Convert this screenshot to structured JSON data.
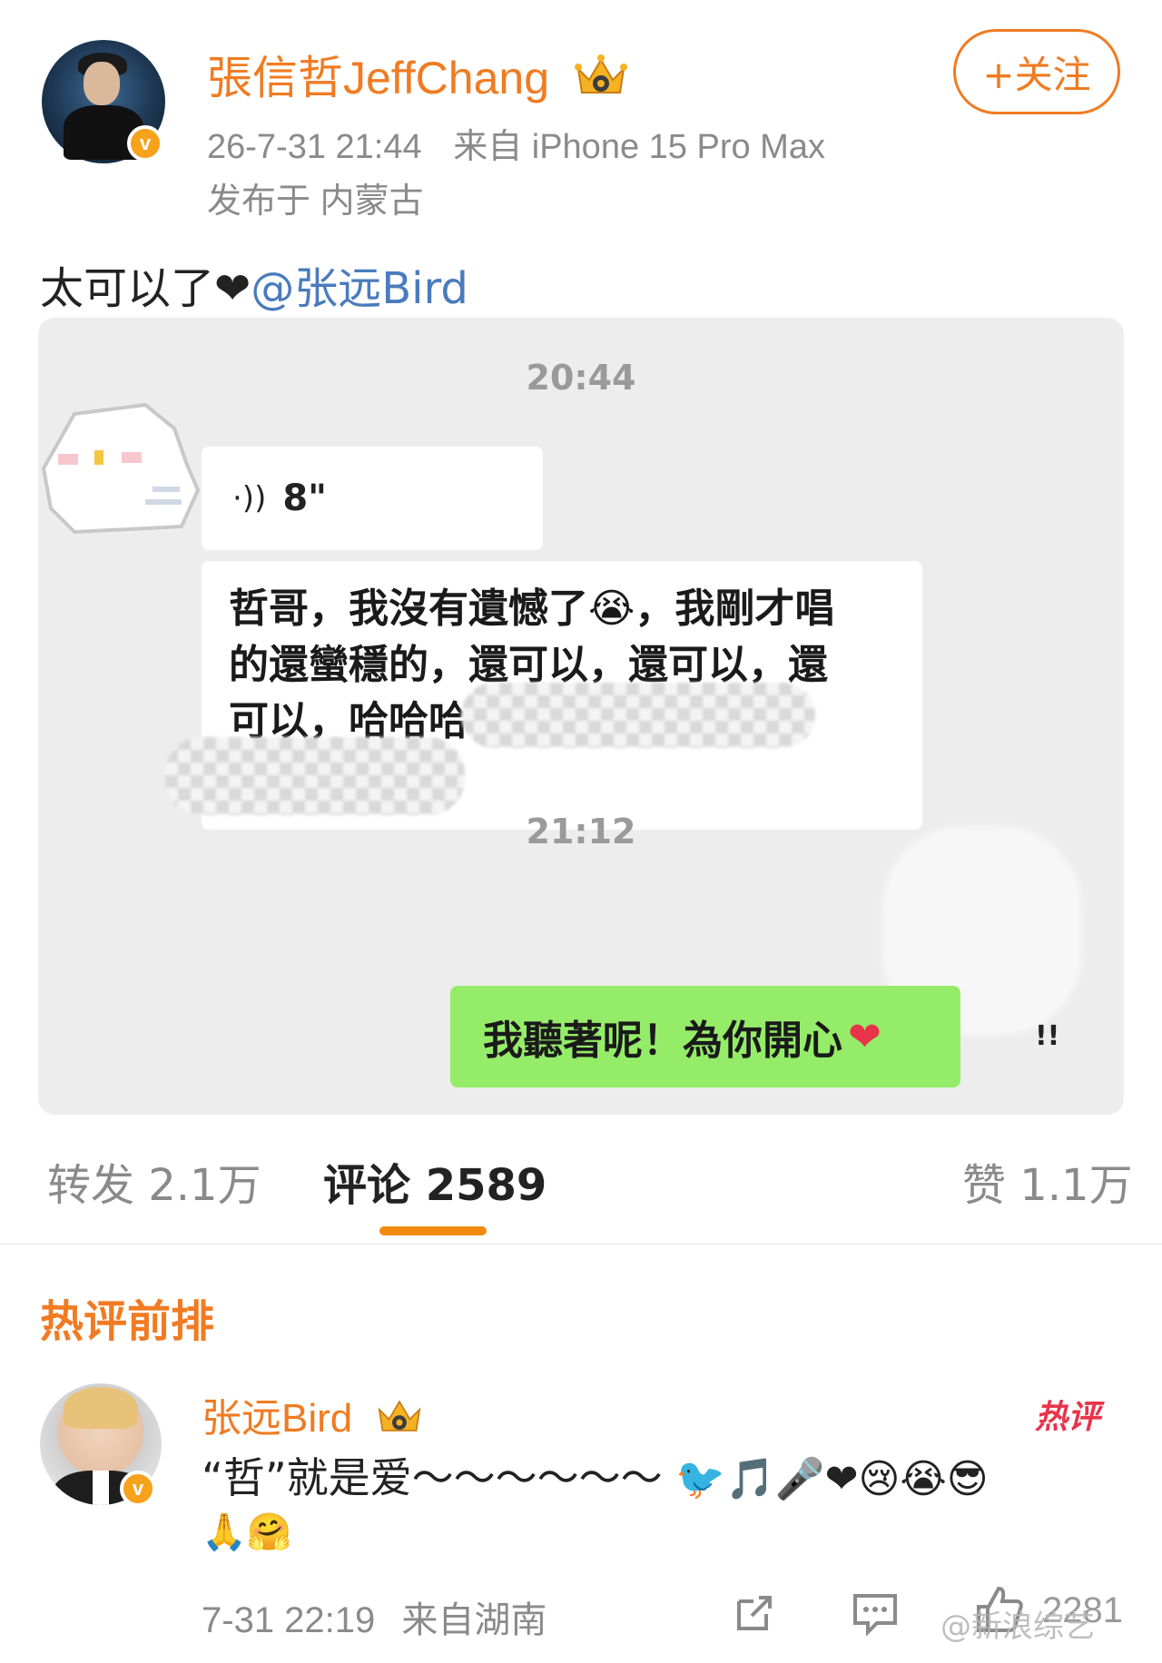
{
  "post": {
    "author_name": "張信哲JeffChang",
    "time": "26-7-31 21:44",
    "source": "来自 iPhone 15 Pro Max",
    "location": "发布于 内蒙古",
    "follow_label": "+关注",
    "text": "太可以了❤",
    "mention": "@张远Bird"
  },
  "chat": {
    "time1": "20:44",
    "voice_duration": "8\"",
    "message_lines": [
      "哲哥，我沒有遺憾了😭，我剛才唱",
      "的還蠻穩的，還可以，還可以，還",
      "可以，哈哈哈，"
    ],
    "time2": "21:12",
    "reply": "我聽著呢！為你開心",
    "reply_emoji": "❤",
    "mark": "!!"
  },
  "tabs": {
    "repost": "转发 2.1万",
    "comments": "评论 2589",
    "likes": "赞 1.1万"
  },
  "hot_section": {
    "heading": "热评前排"
  },
  "comment": {
    "author": "张远Bird",
    "hot_tag": "热评",
    "text": "“哲”就是爱～～～～～～",
    "emojis": "🐦🎵🎤❤😢😭😎",
    "emojis_line2": "🙏🤗",
    "time": "7-31 22:19",
    "source": "来自湖南",
    "like_count": "2281"
  },
  "watermark": "@新浪综艺",
  "colors": {
    "accent": "#f07b22",
    "mention": "#4a7bbd",
    "chat_bg": "#ededed",
    "wechat_green": "#95ec69"
  },
  "icons": [
    "verified-badge-icon",
    "crown-icon",
    "voice-icon",
    "share-icon",
    "comment-icon",
    "like-icon"
  ]
}
